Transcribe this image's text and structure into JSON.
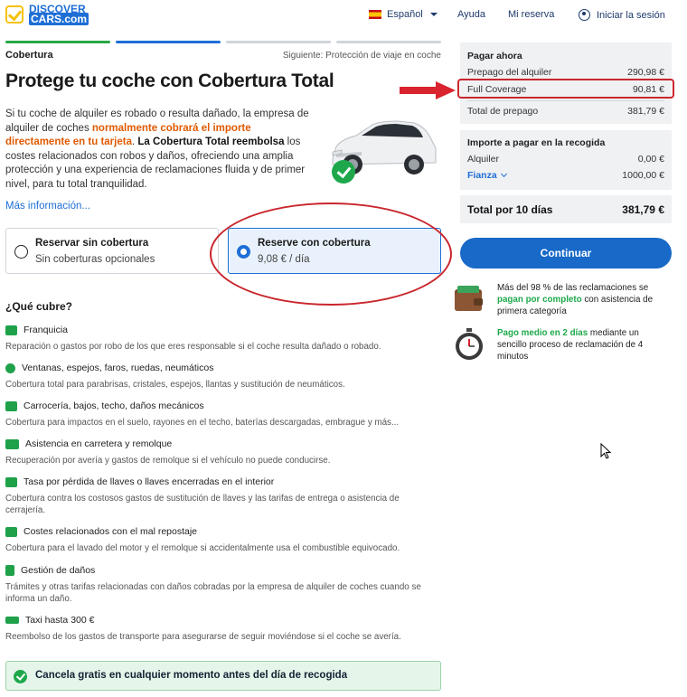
{
  "header": {
    "logo_line1": "DISCOVER",
    "logo_line2": "CARS.com",
    "language": "Español",
    "help": "Ayuda",
    "my_booking": "Mi reserva",
    "login": "Iniciar la sesión"
  },
  "steps": {
    "current": "Cobertura",
    "next": "Siguiente: Protección de viaje en coche"
  },
  "title": "Protege tu coche con Cobertura Total",
  "intro": {
    "p1": "Si tu coche de alquiler es robado o resulta dañado, la empresa de alquiler de coches ",
    "highlight": "normalmente cobrará el importe directamente en tu tarjeta",
    "p2": ". ",
    "bold": "La Cobertura Total reembolsa",
    "p3": " los costes relacionados con robos y daños, ofreciendo una amplia protección y una experiencia de reclamaciones fluida y de primer nivel, para tu total tranquilidad.",
    "more": "Más información..."
  },
  "options": [
    {
      "title": "Reservar sin cobertura",
      "subtitle": "Sin coberturas opcionales",
      "selected": false
    },
    {
      "title": "Reserve con cobertura",
      "subtitle": "9,08 € / día",
      "selected": true
    }
  ],
  "covers": {
    "title": "¿Qué cubre?",
    "items": [
      {
        "icon": "car-key-icon",
        "title": "Franquicia",
        "desc": "Reparación o gastos por robo de los que eres responsable si el coche resulta dañado o robado."
      },
      {
        "icon": "tire-icon",
        "title": "Ventanas, espejos, faros, ruedas, neumáticos",
        "desc": "Cobertura total para parabrisas, cristales, espejos, llantas y sustitución de neumáticos."
      },
      {
        "icon": "car-body-icon",
        "title": "Carrocería, bajos, techo, daños mecánicos",
        "desc": "Cobertura para impactos en el suelo, rayones en el techo, baterías descargadas, embrague y más..."
      },
      {
        "icon": "tow-truck-icon",
        "title": "Asistencia en carretera y remolque",
        "desc": "Recuperación por avería y gastos de remolque si el vehículo no puede conducirse."
      },
      {
        "icon": "keys-icon",
        "title": "Tasa por pérdida de llaves o llaves encerradas en el interior",
        "desc": "Cobertura contra los costosos gastos de sustitución de llaves y las tarifas de entrega o asistencia de cerrajería."
      },
      {
        "icon": "fuel-pump-icon",
        "title": "Costes relacionados con el mal repostaje",
        "desc": "Cobertura para el lavado del motor y el remolque si accidentalmente usa el combustible equivocado."
      },
      {
        "icon": "document-icon",
        "title": "Gestión de daños",
        "desc": "Trámites y otras tarifas relacionadas con daños cobradas por la empresa de alquiler de coches cuando se informa un daño."
      },
      {
        "icon": "plane-icon",
        "title": "Taxi hasta 300 €",
        "desc": "Reembolso de los gastos de transporte para asegurarse de seguir moviéndose si el coche se avería."
      }
    ]
  },
  "cancel_text": "Cancela gratis en cualquier momento antes del día de recogida",
  "summary": {
    "pay_now_title": "Pagar ahora",
    "rental_prepay_label": "Prepago del alquiler",
    "rental_prepay_value": "290,98 €",
    "full_coverage_label": "Full Coverage",
    "full_coverage_value": "90,81 €",
    "prepay_total_label": "Total de prepago",
    "prepay_total_value": "381,79 €",
    "pickup_title": "Importe a pagar en la recogida",
    "rental_label": "Alquiler",
    "rental_value": "0,00 €",
    "deposit_label": "Fianza",
    "deposit_value": "1000,00 €",
    "total_label": "Total por 10 días",
    "total_value": "381,79 €"
  },
  "continue_label": "Continuar",
  "features": [
    {
      "pre": "Más del 98 % de las reclamaciones se ",
      "green": "pagan por completo",
      "post": " con asistencia de primera categoría"
    },
    {
      "pre": "",
      "green": "Pago medio en 2 días",
      "post": " mediante un sencillo proceso de reclamación de 4 minutos"
    }
  ],
  "colors": {
    "primary": "#1869c8",
    "green": "#1ea84b",
    "highlight_orange": "#e05a00",
    "annotation_red": "#c9262d"
  }
}
